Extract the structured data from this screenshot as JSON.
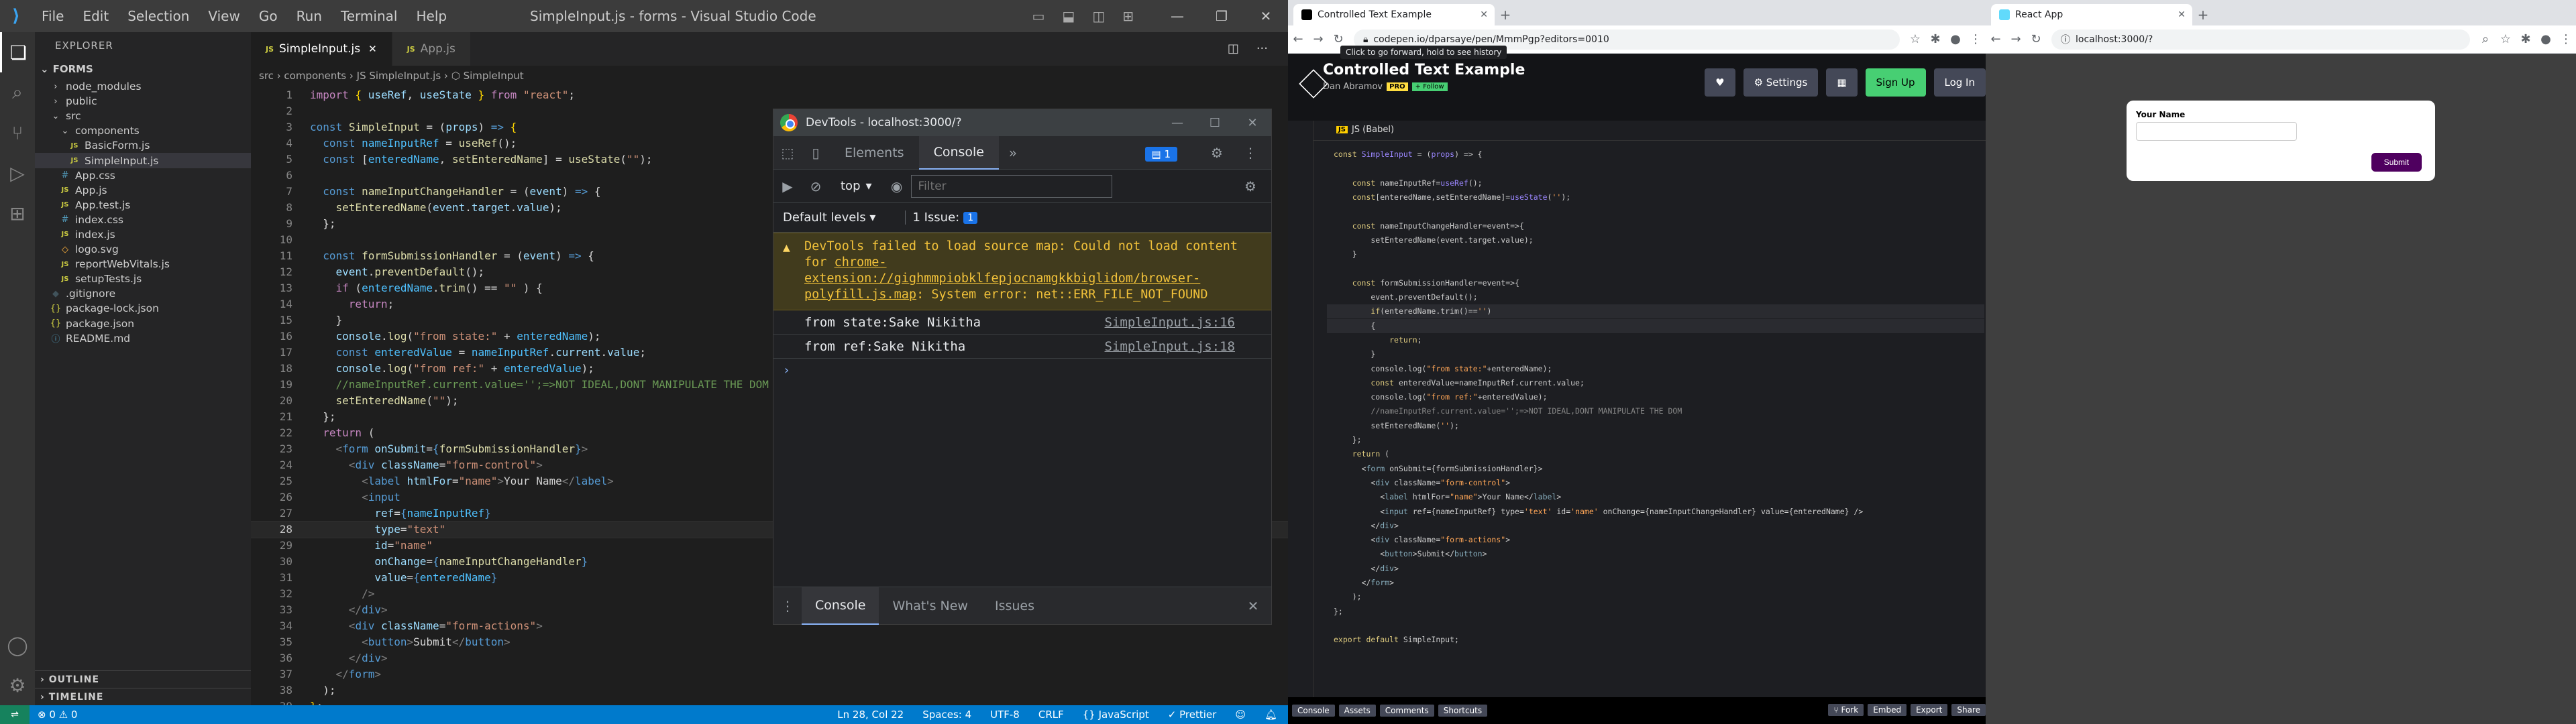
{
  "vscode": {
    "menu": [
      "File",
      "Edit",
      "Selection",
      "View",
      "Go",
      "Run",
      "Terminal",
      "Help"
    ],
    "window_title": "SimpleInput.js - forms - Visual Studio Code",
    "explorer_title": "EXPLORER",
    "project": "FORMS",
    "tree": [
      {
        "label": "node_modules",
        "indent": 1,
        "icon": "›",
        "color": "#ccc"
      },
      {
        "label": "public",
        "indent": 1,
        "icon": "›",
        "color": "#ccc"
      },
      {
        "label": "src",
        "indent": 1,
        "icon": "⌄",
        "color": "#ccc"
      },
      {
        "label": "components",
        "indent": 2,
        "icon": "⌄",
        "color": "#ccc"
      },
      {
        "label": "BasicForm.js",
        "indent": 3,
        "icon": "JS",
        "color": "#cbcb41"
      },
      {
        "label": "SimpleInput.js",
        "indent": 3,
        "icon": "JS",
        "color": "#cbcb41",
        "selected": true
      },
      {
        "label": "App.css",
        "indent": 2,
        "icon": "#",
        "color": "#519aba"
      },
      {
        "label": "App.js",
        "indent": 2,
        "icon": "JS",
        "color": "#cbcb41"
      },
      {
        "label": "App.test.js",
        "indent": 2,
        "icon": "JS",
        "color": "#cbcb41"
      },
      {
        "label": "index.css",
        "indent": 2,
        "icon": "#",
        "color": "#519aba"
      },
      {
        "label": "index.js",
        "indent": 2,
        "icon": "JS",
        "color": "#cbcb41"
      },
      {
        "label": "logo.svg",
        "indent": 2,
        "icon": "◇",
        "color": "#ffb13b"
      },
      {
        "label": "reportWebVitals.js",
        "indent": 2,
        "icon": "JS",
        "color": "#cbcb41"
      },
      {
        "label": "setupTests.js",
        "indent": 2,
        "icon": "JS",
        "color": "#cbcb41"
      },
      {
        "label": ".gitignore",
        "indent": 1,
        "icon": "◆",
        "color": "#41535b"
      },
      {
        "label": "package-lock.json",
        "indent": 1,
        "icon": "{}",
        "color": "#cbcb41"
      },
      {
        "label": "package.json",
        "indent": 1,
        "icon": "{}",
        "color": "#cbcb41"
      },
      {
        "label": "README.md",
        "indent": 1,
        "icon": "ⓘ",
        "color": "#519aba"
      }
    ],
    "outline": "OUTLINE",
    "timeline": "TIMELINE",
    "tabs": [
      {
        "label": "SimpleInput.js",
        "active": true
      },
      {
        "label": "App.js",
        "active": false
      }
    ],
    "breadcrumb": "src › components › JS SimpleInput.js › ⬡ SimpleInput",
    "current_line": 28,
    "code_lines": [
      "<span class='kp'>import</span> <span class='br'>{</span> <span class='vr'>useRef</span>, <span class='vr'>useState</span> <span class='br'>}</span> <span class='kp'>from</span> <span class='st'>\"react\"</span>;",
      "",
      "<span class='kw'>const</span> <span class='fn'>SimpleInput</span> = (<span class='vr'>props</span>) <span class='kw'>=&gt;</span> <span class='br'>{</span>",
      "  <span class='kw'>const</span> <span class='cs'>nameInputRef</span> = <span class='fn'>useRef</span>();",
      "  <span class='kw'>const</span> [<span class='cs'>enteredName</span>, <span class='fn'>setEnteredName</span>] = <span class='fn'>useState</span>(<span class='st'>\"\"</span>);",
      "",
      "  <span class='kw'>const</span> <span class='fn'>nameInputChangeHandler</span> = (<span class='vr'>event</span>) <span class='kw'>=&gt;</span> {",
      "    <span class='fn'>setEnteredName</span>(<span class='vr'>event</span>.<span class='vr'>target</span>.<span class='vr'>value</span>);",
      "  };",
      "",
      "  <span class='kw'>const</span> <span class='fn'>formSubmissionHandler</span> = (<span class='vr'>event</span>) <span class='kw'>=&gt;</span> {",
      "    <span class='vr'>event</span>.<span class='fn'>preventDefault</span>();",
      "    <span class='kp'>if</span> (<span class='cs'>enteredName</span>.<span class='fn'>trim</span>() == <span class='st'>\"\"</span> ) {",
      "      <span class='kp'>return</span>;",
      "    }",
      "    <span class='vr'>console</span>.<span class='fn'>log</span>(<span class='st'>\"from state:\"</span> + <span class='cs'>enteredName</span>);",
      "    <span class='kw'>const</span> <span class='cs'>enteredValue</span> = <span class='cs'>nameInputRef</span>.<span class='vr'>current</span>.<span class='vr'>value</span>;",
      "    <span class='vr'>console</span>.<span class='fn'>log</span>(<span class='st'>\"from ref:\"</span> + <span class='cs'>enteredValue</span>);",
      "    <span class='cm'>//nameInputRef.current.value='';=&gt;NOT IDEAL,DONT MANIPULATE THE DOM</span>",
      "    <span class='fn'>setEnteredName</span>(<span class='st'>\"\"</span>);",
      "  };",
      "  <span class='kp'>return</span> (",
      "    <span class='pl'>&lt;</span><span class='tg'>form</span> <span class='at'>onSubmit</span>=<span class='kw'>{</span><span class='fn'>formSubmissionHandler</span><span class='kw'>}</span><span class='pl'>&gt;</span>",
      "      <span class='pl'>&lt;</span><span class='tg'>div</span> <span class='at'>className</span>=<span class='st'>\"form-control\"</span><span class='pl'>&gt;</span>",
      "        <span class='pl'>&lt;</span><span class='tg'>label</span> <span class='at'>htmlFor</span>=<span class='st'>\"name\"</span><span class='pl'>&gt;</span>Your Name<span class='pl'>&lt;/</span><span class='tg'>label</span><span class='pl'>&gt;</span>",
      "        <span class='pl'>&lt;</span><span class='tg'>input</span>",
      "          <span class='at'>ref</span>=<span class='kw'>{</span><span class='cs'>nameInputRef</span><span class='kw'>}</span>",
      "          <span class='at'>type</span>=<span class='st'>\"text\"</span>",
      "          <span class='at'>id</span>=<span class='st'>\"name\"</span>",
      "          <span class='at'>onChange</span>=<span class='kw'>{</span><span class='fn'>nameInputChangeHandler</span><span class='kw'>}</span>",
      "          <span class='at'>value</span>=<span class='kw'>{</span><span class='cs'>enteredName</span><span class='kw'>}</span>",
      "        <span class='pl'>/&gt;</span>",
      "      <span class='pl'>&lt;/</span><span class='tg'>div</span><span class='pl'>&gt;</span>",
      "      <span class='pl'>&lt;</span><span class='tg'>div</span> <span class='at'>className</span>=<span class='st'>\"form-actions\"</span><span class='pl'>&gt;</span>",
      "        <span class='pl'>&lt;</span><span class='tg'>button</span><span class='pl'>&gt;</span>Submit<span class='pl'>&lt;/</span><span class='tg'>button</span><span class='pl'>&gt;</span>",
      "      <span class='pl'>&lt;/</span><span class='tg'>div</span><span class='pl'>&gt;</span>",
      "    <span class='pl'>&lt;/</span><span class='tg'>form</span><span class='pl'>&gt;</span>",
      "  );",
      "<span class='br'>}</span>;"
    ],
    "status": {
      "left": "⊗ 0 ⚠ 0",
      "position": "Ln 28, Col 22",
      "spaces": "Spaces: 4",
      "encoding": "UTF-8",
      "eol": "CRLF",
      "language": "{} JavaScript",
      "prettier": "✓ Prettier"
    },
    "colors": {
      "status_bar": "#007acc",
      "activity": "#333333",
      "sidebar": "#252526",
      "editor": "#1e1e1e"
    }
  },
  "devtools": {
    "title": "DevTools - localhost:3000/?",
    "tabs": [
      "Elements",
      "Console"
    ],
    "active_tab": "Console",
    "issues_badge": "1",
    "context": "top",
    "filter_placeholder": "Filter",
    "levels": "Default levels",
    "issue_count": "1 Issue:",
    "issue_badge_num": "1",
    "warning": {
      "prefix": "DevTools failed to load source map: Could not load content for ",
      "link": "chrome-extension://gighmmpiobklfepjocnamgkkbiglidom/browser-polyfill.js.map",
      "suffix": ": System error: net::ERR_FILE_NOT_FOUND"
    },
    "logs": [
      {
        "msg": "from state:Sake Nikitha",
        "source": "SimpleInput.js:16"
      },
      {
        "msg": "from ref:Sake Nikitha",
        "source": "SimpleInput.js:18"
      }
    ],
    "drawer_tabs": [
      "Console",
      "What's New",
      "Issues"
    ],
    "drawer_active": "Console"
  },
  "codepen_browser": {
    "tab_title": "Controlled Text Example",
    "url": "codepen.io/dparsaye/pen/MmmPgp?editors=0010",
    "tooltip": "Click to go forward, hold to see history",
    "pen_title": "Controlled Text Example",
    "author": "Dan Abramov",
    "pro": "PRO",
    "follow": "+ Follow",
    "buttons": [
      "♥",
      "⚙ Settings",
      "▦",
      "Sign Up",
      "Log In"
    ],
    "js_label": "JS (Babel)",
    "code": [
      "<span class='cpk'>const</span> <span class='cpv'>SimpleInput</span> = (<span class='cpv'>props</span>) =&gt; {",
      "",
      "    <span class='cpk'>const</span> nameInputRef=<span class='cpv'>useRef</span>();",
      "    <span class='cpk'>const</span>[enteredName,setEnteredName]=<span class='cpv'>useState</span>(<span class='cps'>''</span>);",
      "",
      "    <span class='cpk'>const</span> nameInputChangeHandler=event=&gt;{",
      "        setEnteredName(event.target.value);",
      "    }",
      "",
      "    <span class='cpk'>const</span> formSubmissionHandler=event=&gt;{",
      "        event.preventDefault();",
      "        <span class='cpk'>if</span>(enteredName.trim()==<span class='cps'>''</span>)",
      "        {",
      "            <span class='cpk'>return</span>;",
      "        }",
      "        console.log(<span class='cps'>\"from state:\"</span>+enteredName);",
      "        <span class='cpk'>const</span> enteredValue=nameInputRef.current.value;",
      "        console.log(<span class='cps'>\"from ref:\"</span>+enteredValue);",
      "        <span class='cpc'>//nameInputRef.current.value='';=&gt;NOT IDEAL,DONT MANIPULATE THE DOM</span>",
      "        setEnteredName(<span class='cps'>''</span>);",
      "    };",
      "    <span class='cpk'>return</span> (",
      "      &lt;<span class='cpt'>form</span> onSubmit={formSubmissionHandler}&gt;",
      "        &lt;<span class='cpt'>div</span> className=<span class='cps'>\"form-control\"</span>&gt;",
      "          &lt;<span class='cpt'>label</span> htmlFor=<span class='cps'>\"name\"</span>&gt;Your Name&lt;/<span class='cpt'>label</span>&gt;",
      "          &lt;<span class='cpt'>input</span> ref={nameInputRef} type=<span class='cps'>'text'</span> id=<span class='cps'>'name'</span> onChange={nameInputChangeHandler} value={enteredName} /&gt;",
      "        &lt;/<span class='cpt'>div</span>&gt;",
      "        &lt;<span class='cpt'>div</span> className=<span class='cps'>\"form-actions\"</span>&gt;",
      "          &lt;<span class='cpt'>button</span>&gt;Submit&lt;/<span class='cpt'>button</span>&gt;",
      "        &lt;/<span class='cpt'>div</span>&gt;",
      "      &lt;/<span class='cpt'>form</span>&gt;",
      "    );",
      "};",
      "",
      "<span class='cpk'>export default</span> SimpleInput;"
    ],
    "footer_left": [
      "Console",
      "Assets",
      "Comments",
      "Shortcuts"
    ],
    "footer_right": [
      "⑂ Fork",
      "Embed",
      "Export",
      "Share"
    ]
  },
  "react_browser": {
    "tab_title": "React App",
    "url": "localhost:3000/?",
    "label": "Your Name",
    "submit": "Submit"
  }
}
